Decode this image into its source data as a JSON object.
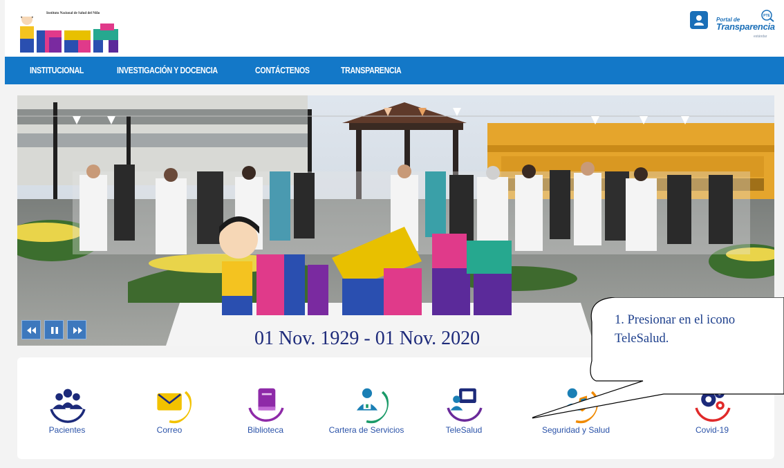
{
  "header": {
    "logo_small_text": "Instituto Nacional de Salud del Niño",
    "portal_label_line1": "Portal de",
    "portal_label_line2": "Transparencia",
    "portal_label_line3": "estándar",
    "portal_badge": "PTE"
  },
  "nav": {
    "items": [
      {
        "label": "INSTITUCIONAL"
      },
      {
        "label": "INVESTIGACIÓN Y DOCENCIA"
      },
      {
        "label": "CONTÁCTENOS"
      },
      {
        "label": "TRANSPARENCIA"
      }
    ]
  },
  "banner": {
    "date_text": "01 Nov. 1929 - 01 Nov. 2020",
    "controls": [
      "rewind-icon",
      "pause-icon",
      "fast-forward-icon"
    ]
  },
  "services": [
    {
      "label": "Pacientes",
      "icon": "patients-icon",
      "ring_color": "#1c2a7a"
    },
    {
      "label": "Correo",
      "icon": "mail-icon",
      "ring_color": "#f2c200"
    },
    {
      "label": "Biblioteca",
      "icon": "book-icon",
      "ring_color": "#8e2aa8"
    },
    {
      "label": "Cartera de Servicios",
      "icon": "doctor-icon",
      "ring_color": "#1a9a68"
    },
    {
      "label": "TeleSalud",
      "icon": "telehealth-icon",
      "ring_color": "#6a2a9a"
    },
    {
      "label": "Seguridad y Salud",
      "icon": "safety-icon",
      "ring_color": "#f08a00"
    },
    {
      "label": "Covid-19",
      "icon": "virus-gear-icon",
      "ring_color": "#e02a2a"
    }
  ],
  "callout": {
    "line1": "1. Presionar en el icono",
    "line2": "TeleSalud."
  },
  "colors": {
    "nav_blue": "#1378c8",
    "link_blue": "#2a52a8",
    "brand_navy": "#1c2a7a"
  }
}
